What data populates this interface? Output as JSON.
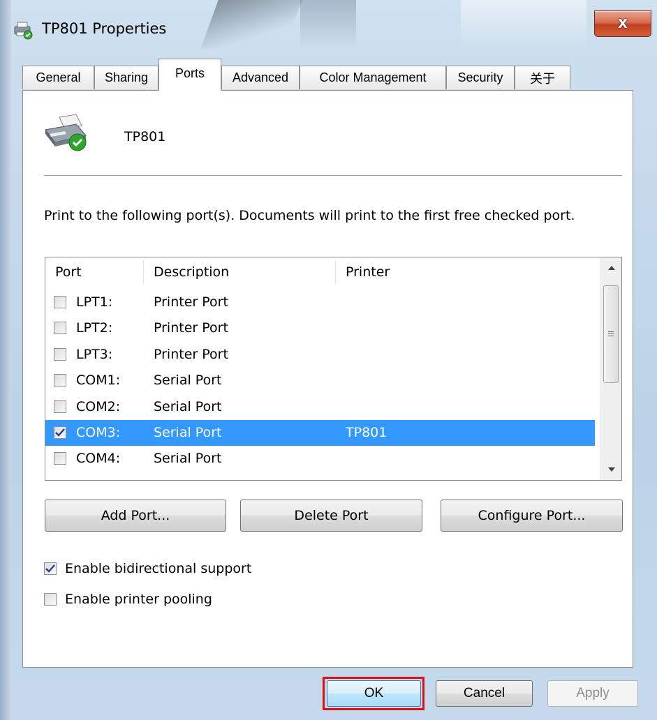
{
  "window": {
    "title": "TP801 Properties",
    "close_label": "X"
  },
  "tabs": [
    {
      "label": "General"
    },
    {
      "label": "Sharing"
    },
    {
      "label": "Ports"
    },
    {
      "label": "Advanced"
    },
    {
      "label": "Color Management"
    },
    {
      "label": "Security"
    },
    {
      "label": "关于"
    }
  ],
  "active_tab": "Ports",
  "printer": {
    "name": "TP801",
    "icon": "printer-icon"
  },
  "description": "Print to the following port(s). Documents will print to the first free checked port.",
  "port_list": {
    "headers": [
      "Port",
      "Description",
      "Printer"
    ],
    "rows": [
      {
        "port": "LPT1:",
        "description": "Printer Port",
        "printer": "",
        "checked": false,
        "selected": false
      },
      {
        "port": "LPT2:",
        "description": "Printer Port",
        "printer": "",
        "checked": false,
        "selected": false
      },
      {
        "port": "LPT3:",
        "description": "Printer Port",
        "printer": "",
        "checked": false,
        "selected": false
      },
      {
        "port": "COM1:",
        "description": "Serial Port",
        "printer": "",
        "checked": false,
        "selected": false
      },
      {
        "port": "COM2:",
        "description": "Serial Port",
        "printer": "",
        "checked": false,
        "selected": false
      },
      {
        "port": "COM3:",
        "description": "Serial Port",
        "printer": "TP801",
        "checked": true,
        "selected": true
      },
      {
        "port": "COM4:",
        "description": "Serial Port",
        "printer": "",
        "checked": false,
        "selected": false
      }
    ]
  },
  "buttons": {
    "add_port": "Add Port...",
    "delete_port": "Delete Port",
    "configure_port": "Configure Port..."
  },
  "options": {
    "bidirectional": {
      "label": "Enable bidirectional support",
      "checked": true
    },
    "pooling": {
      "label": "Enable printer pooling",
      "checked": false
    }
  },
  "footer": {
    "ok": "OK",
    "cancel": "Cancel",
    "apply": "Apply"
  },
  "colors": {
    "selection": "#3399ff",
    "highlight_box": "#e01010",
    "close_button": "#c2411d"
  }
}
